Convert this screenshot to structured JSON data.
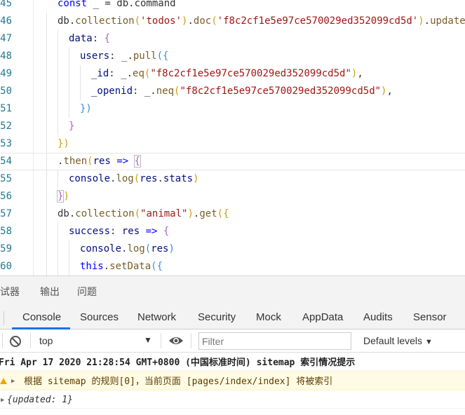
{
  "editor": {
    "lines": [
      {
        "n": "45",
        "code": [
          [
            "kw",
            "const "
          ],
          [
            "pl",
            "_ = db.command"
          ]
        ]
      },
      {
        "n": "46",
        "code": [
          [
            "pl",
            "db."
          ],
          [
            "fn",
            "collection"
          ],
          [
            "b1",
            "("
          ],
          [
            "str",
            "'todos'"
          ],
          [
            "b1",
            ")"
          ],
          [
            "pl",
            "."
          ],
          [
            "fn",
            "doc"
          ],
          [
            "b1",
            "("
          ],
          [
            "str",
            "'f8c2cf1e5e97ce570029ed352099cd5d'"
          ],
          [
            "b1",
            ")"
          ],
          [
            "pl",
            "."
          ],
          [
            "fn",
            "update"
          ],
          [
            "b1",
            "({"
          ]
        ]
      },
      {
        "n": "47",
        "code": [
          [
            "pr",
            "data"
          ],
          [
            "pl",
            ": "
          ],
          [
            "b2",
            "{"
          ]
        ]
      },
      {
        "n": "48",
        "code": [
          [
            "pr",
            "users"
          ],
          [
            "pl",
            ": _."
          ],
          [
            "fn",
            "pull"
          ],
          [
            "b3",
            "({"
          ]
        ]
      },
      {
        "n": "49",
        "code": [
          [
            "pr",
            "_id"
          ],
          [
            "pl",
            ": _."
          ],
          [
            "fn",
            "eq"
          ],
          [
            "b1",
            "("
          ],
          [
            "str",
            "\"f8c2cf1e5e97ce570029ed352099cd5d\""
          ],
          [
            "b1",
            ")"
          ],
          [
            "pl",
            ","
          ]
        ]
      },
      {
        "n": "50",
        "code": [
          [
            "pr",
            "_openid"
          ],
          [
            "pl",
            ": _."
          ],
          [
            "fn",
            "neq"
          ],
          [
            "b1",
            "("
          ],
          [
            "str",
            "\"f8c2cf1e5e97ce570029ed352099cd5d\""
          ],
          [
            "b1",
            ")"
          ],
          [
            "pl",
            ","
          ]
        ]
      },
      {
        "n": "51",
        "code": [
          [
            "b3",
            "})"
          ]
        ]
      },
      {
        "n": "52",
        "code": [
          [
            "b2",
            "}"
          ]
        ]
      },
      {
        "n": "53",
        "code": [
          [
            "b1",
            "})"
          ]
        ]
      },
      {
        "n": "54",
        "code": [
          [
            "pl",
            "."
          ],
          [
            "fn",
            "then"
          ],
          [
            "b1",
            "("
          ],
          [
            "pr",
            "res"
          ],
          [
            "pl",
            " "
          ],
          [
            "kw",
            "=>"
          ],
          [
            "pl",
            " "
          ],
          [
            "b2",
            "{"
          ]
        ]
      },
      {
        "n": "55",
        "code": [
          [
            "pr",
            "console"
          ],
          [
            "pl",
            "."
          ],
          [
            "fn",
            "log"
          ],
          [
            "b1",
            "("
          ],
          [
            "pr",
            "res"
          ],
          [
            "pl",
            "."
          ],
          [
            "pr",
            "stats"
          ],
          [
            "b1",
            ")"
          ]
        ]
      },
      {
        "n": "56",
        "code": [
          [
            "b2",
            "}"
          ],
          [
            "b1",
            ")"
          ]
        ]
      },
      {
        "n": "57",
        "code": [
          [
            "pl",
            "db."
          ],
          [
            "fn",
            "collection"
          ],
          [
            "b1",
            "("
          ],
          [
            "str",
            "\"animal\""
          ],
          [
            "b1",
            ")"
          ],
          [
            "pl",
            "."
          ],
          [
            "fn",
            "get"
          ],
          [
            "b1",
            "({"
          ]
        ]
      },
      {
        "n": "58",
        "code": [
          [
            "pr",
            "success"
          ],
          [
            "pl",
            ": "
          ],
          [
            "pr",
            "res"
          ],
          [
            "pl",
            " "
          ],
          [
            "kw",
            "=>"
          ],
          [
            "pl",
            " "
          ],
          [
            "b2",
            "{"
          ]
        ]
      },
      {
        "n": "59",
        "code": [
          [
            "pr",
            "console"
          ],
          [
            "pl",
            "."
          ],
          [
            "fn",
            "log"
          ],
          [
            "b3",
            "("
          ],
          [
            "pr",
            "res"
          ],
          [
            "b3",
            ")"
          ]
        ]
      },
      {
        "n": "60",
        "code": [
          [
            "kw",
            "this"
          ],
          [
            "pl",
            "."
          ],
          [
            "fn",
            "setData"
          ],
          [
            "b3",
            "({"
          ]
        ]
      }
    ]
  },
  "panel": {
    "tabs": [
      "调试器",
      "输出",
      "问题"
    ]
  },
  "devtools": {
    "tabs": [
      "Console",
      "Sources",
      "Network",
      "Security",
      "Mock",
      "AppData",
      "Audits",
      "Sensor"
    ],
    "active_tab": "Console"
  },
  "toolbar": {
    "context": "top",
    "filter_placeholder": "Filter",
    "levels": "Default levels"
  },
  "console": {
    "header": "Fri Apr 17 2020 21:28:54 GMT+0800 (中国标准时间) sitemap 索引情况提示",
    "warning": "根据 sitemap 的规则[0]，当前页面 [pages/index/index] 将被索引",
    "object_text": "{updated: 1}"
  },
  "colors": {
    "accent": "#1a73e8",
    "warning_bg": "#fffbe5",
    "warning_icon": "#f2a600"
  }
}
